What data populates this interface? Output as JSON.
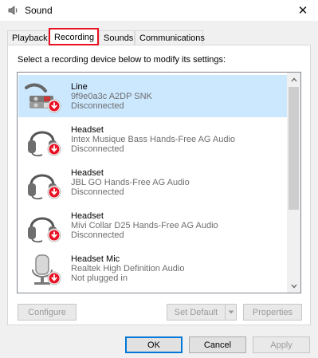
{
  "window": {
    "title": "Sound",
    "close_glyph": "✕"
  },
  "tabs": [
    {
      "label": "Playback",
      "active": false
    },
    {
      "label": "Recording",
      "active": true
    },
    {
      "label": "Sounds",
      "active": false
    },
    {
      "label": "Communications",
      "active": false
    }
  ],
  "instruction": "Select a recording device below to modify its settings:",
  "devices": [
    {
      "name": "Line",
      "detail": "9f9e0a3c A2DP SNK",
      "status": "Disconnected",
      "icon": "line-in-icon",
      "selected": true
    },
    {
      "name": "Headset",
      "detail": "Intex Musique Bass Hands-Free AG Audio",
      "status": "Disconnected",
      "icon": "headset-icon",
      "selected": false
    },
    {
      "name": "Headset",
      "detail": "JBL GO Hands-Free AG Audio",
      "status": "Disconnected",
      "icon": "headset-icon",
      "selected": false
    },
    {
      "name": "Headset",
      "detail": "Mivi Collar D25 Hands-Free AG Audio",
      "status": "Disconnected",
      "icon": "headset-icon",
      "selected": false
    },
    {
      "name": "Headset Mic",
      "detail": "Realtek High Definition Audio",
      "status": "Not plugged in",
      "icon": "microphone-icon",
      "selected": false
    }
  ],
  "buttons": {
    "configure": "Configure",
    "set_default": "Set Default",
    "properties": "Properties",
    "ok": "OK",
    "cancel": "Cancel",
    "apply": "Apply"
  },
  "colors": {
    "selected_row": "#cce8ff",
    "active_tab_highlight": "#e81123",
    "status_badge": "#e81123",
    "default_button_border": "#0078d7"
  }
}
